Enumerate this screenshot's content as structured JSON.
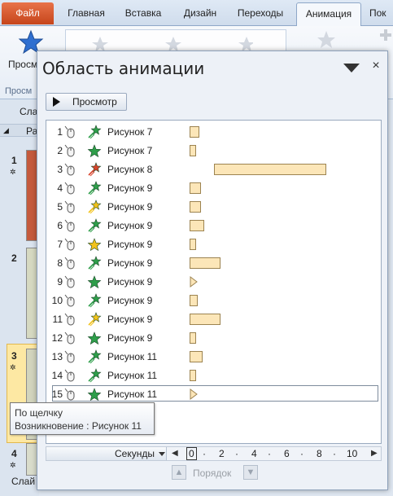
{
  "ribbon": {
    "tabs": [
      "Файл",
      "Главная",
      "Вставка",
      "Дизайн",
      "Переходы",
      "Анимация",
      "Пок"
    ],
    "active_tab": "Анимация",
    "preview_label": "Просм",
    "group_label": "Просм"
  },
  "left_pane": {
    "tab_slides": "Сла",
    "section_label": "Ра",
    "footer_label": "Слай",
    "slide_numbers": [
      "1",
      "2",
      "3",
      "4"
    ]
  },
  "pane": {
    "title": "Область анимации",
    "close_glyph": "×",
    "play_label": "Просмотр",
    "animations": [
      {
        "num": "1",
        "effect": "entrance-green",
        "name": "Рисунок 7",
        "bar_start": 0.0,
        "bar_len": 0.6,
        "kind": "bar"
      },
      {
        "num": "2",
        "effect": "entrance-green-star",
        "name": "Рисунок 7",
        "bar_start": 0.0,
        "bar_len": 0.4,
        "kind": "bar"
      },
      {
        "num": "3",
        "effect": "emphasis-red",
        "name": "Рисунок 8",
        "bar_start": 1.5,
        "bar_len": 6.9,
        "kind": "bar"
      },
      {
        "num": "4",
        "effect": "entrance-green",
        "name": "Рисунок 9",
        "bar_start": 0.0,
        "bar_len": 0.7,
        "kind": "bar"
      },
      {
        "num": "5",
        "effect": "emphasis-yellow",
        "name": "Рисунок 9",
        "bar_start": 0.0,
        "bar_len": 0.7,
        "kind": "bar"
      },
      {
        "num": "6",
        "effect": "entrance-green",
        "name": "Рисунок 9",
        "bar_start": 0.0,
        "bar_len": 0.9,
        "kind": "bar"
      },
      {
        "num": "7",
        "effect": "emphasis-yellow-star",
        "name": "Рисунок 9",
        "bar_start": 0.0,
        "bar_len": 0.4,
        "kind": "bar"
      },
      {
        "num": "8",
        "effect": "entrance-green",
        "name": "Рисунок 9",
        "bar_start": 0.0,
        "bar_len": 1.9,
        "kind": "bar"
      },
      {
        "num": "9",
        "effect": "entrance-green-star",
        "name": "Рисунок 9",
        "bar_start": 0.0,
        "bar_len": 0.0,
        "kind": "triangle"
      },
      {
        "num": "10",
        "effect": "entrance-green",
        "name": "Рисунок 9",
        "bar_start": 0.0,
        "bar_len": 0.5,
        "kind": "bar"
      },
      {
        "num": "11",
        "effect": "emphasis-yellow",
        "name": "Рисунок 9",
        "bar_start": 0.0,
        "bar_len": 1.9,
        "kind": "bar"
      },
      {
        "num": "12",
        "effect": "entrance-green-star",
        "name": "Рисунок 9",
        "bar_start": 0.0,
        "bar_len": 0.4,
        "kind": "bar"
      },
      {
        "num": "13",
        "effect": "entrance-green",
        "name": "Рисунок 11",
        "bar_start": 0.0,
        "bar_len": 0.8,
        "kind": "bar"
      },
      {
        "num": "14",
        "effect": "entrance-green",
        "name": "Рисунок 11",
        "bar_start": 0.0,
        "bar_len": 0.4,
        "kind": "bar"
      },
      {
        "num": "15",
        "effect": "entrance-green-star",
        "name": "Рисунок 11",
        "bar_start": 0.0,
        "bar_len": 0.0,
        "kind": "triangle",
        "selected": true
      }
    ],
    "timeline": {
      "seconds_label": "Секунды",
      "ticks": [
        "0",
        "2",
        "4",
        "6",
        "8",
        "10"
      ],
      "zoom_seconds_per_tick": 2
    },
    "order_label": "Порядок",
    "tooltip": {
      "line1": "По щелчку",
      "line2": "Возникновение : Рисунок 11"
    }
  },
  "colors": {
    "bar_fill": "#fce6b8",
    "bar_border": "#9c8350",
    "entrance_green": "#2e9e4a",
    "emphasis_yellow": "#f2c21a",
    "emphasis_red": "#d8432b",
    "file_tab": "#d2572a"
  }
}
